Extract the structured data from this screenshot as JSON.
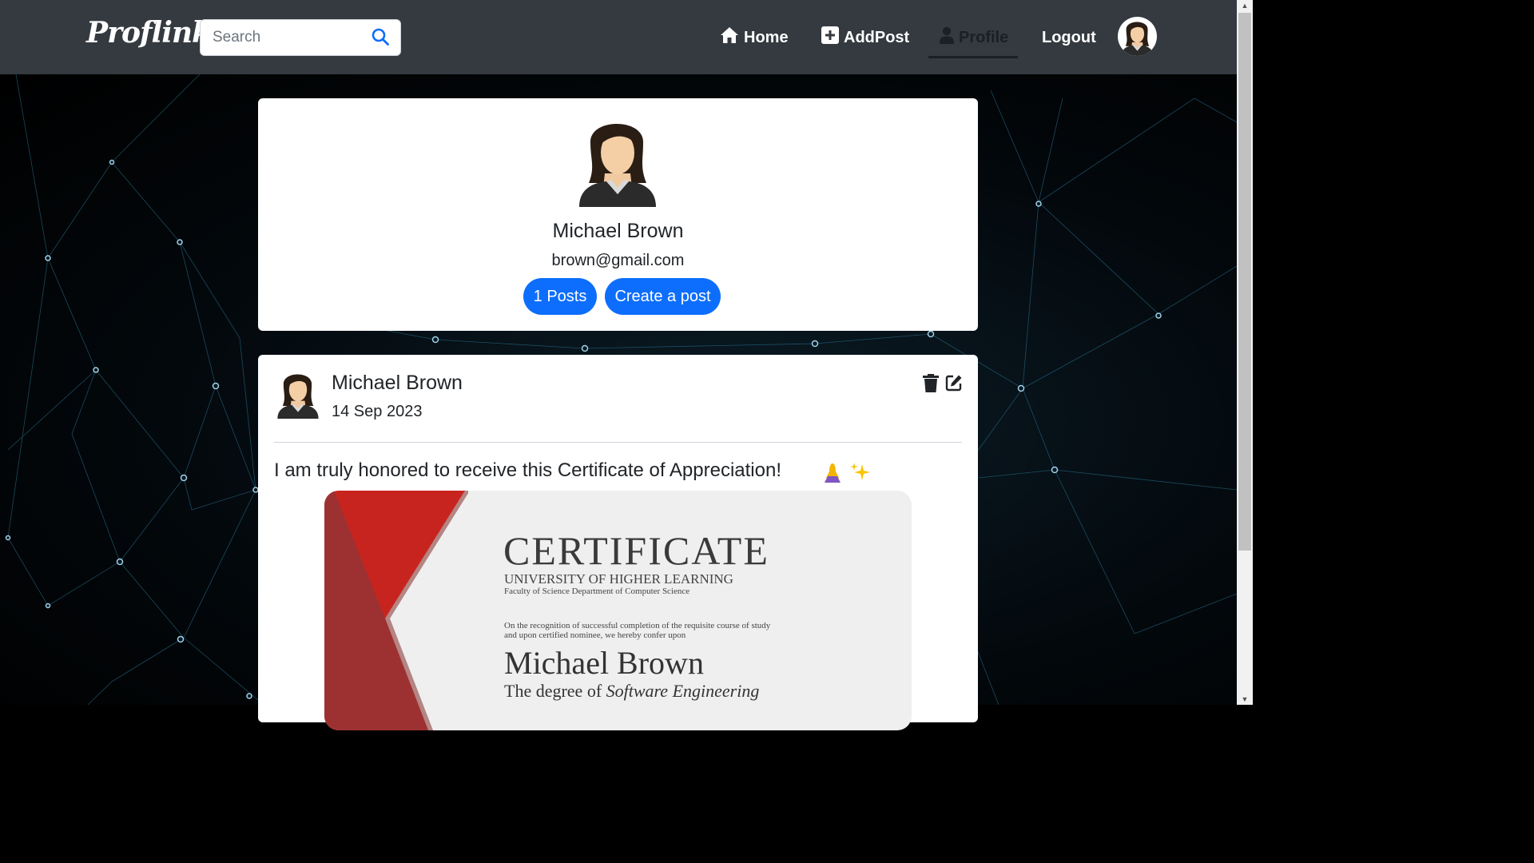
{
  "brand": "Proflink",
  "search": {
    "placeholder": "Search"
  },
  "nav": {
    "home": "Home",
    "add_post": "AddPost",
    "profile": "Profile",
    "logout": "Logout"
  },
  "profile": {
    "name": "Michael Brown",
    "email": "brown@gmail.com",
    "posts_button": "1 Posts",
    "create_button": "Create a post"
  },
  "post": {
    "author": "Michael Brown",
    "date": "14 Sep 2023",
    "text": "I am truly honored to receive this Certificate of Appreciation!",
    "emojis": [
      "🙏",
      "✨"
    ],
    "certificate": {
      "title": "CERTIFICATE",
      "university": "UNIVERSITY OF HIGHER LEARNING",
      "faculty": "Faculty of Science Department of Computer Science",
      "line1": "On the recognition of successful completion of the requisite course of study",
      "line2": "and upon certified nominee, we hereby confer upon",
      "recipient": "Michael Brown",
      "degree_prefix": "The degree of",
      "degree": "Software Engineering"
    }
  },
  "icons": {
    "search": "search-icon",
    "home": "home-icon",
    "add": "plus-square-icon",
    "profile": "user-icon",
    "delete": "trash-icon",
    "edit": "edit-icon"
  },
  "colors": {
    "navbar": "#343a40",
    "accent": "#0d6efd",
    "certificate_red": "#c8241f"
  }
}
